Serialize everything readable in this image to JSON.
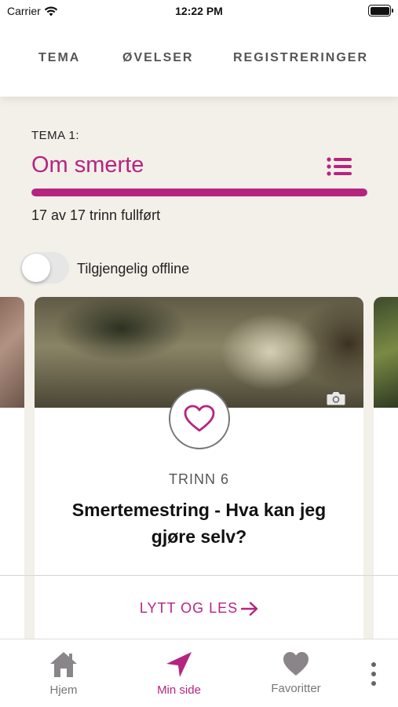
{
  "status_bar": {
    "carrier": "Carrier",
    "time": "12:22 PM"
  },
  "tabs": [
    {
      "label": "TEMA"
    },
    {
      "label": "ØVELSER"
    },
    {
      "label": "REGISTRERINGER"
    }
  ],
  "theme": {
    "label": "TEMA 1:",
    "title": "Om smerte",
    "progress_text": "17 av 17 trinn fullført",
    "progress_fraction": 1.0
  },
  "offline": {
    "label": "Tilgjengelig offline",
    "enabled": false
  },
  "card": {
    "step": "TRINN 6",
    "title": "Smertemestring - Hva kan jeg gjøre selv?",
    "action": "LYTT OG LES"
  },
  "bottom_nav": {
    "home": "Hjem",
    "my_page": "Min side",
    "favorites": "Favoritter"
  },
  "colors": {
    "accent": "#b5257f",
    "background": "#f3efe9",
    "icon_gray": "#8a8588"
  },
  "icons": [
    "wifi-icon",
    "battery-icon",
    "list-icon",
    "camera-icon",
    "heart-icon",
    "arrow-right-icon",
    "home-icon",
    "navigation-arrow-icon",
    "heart-filled-icon",
    "more-vertical-icon"
  ]
}
